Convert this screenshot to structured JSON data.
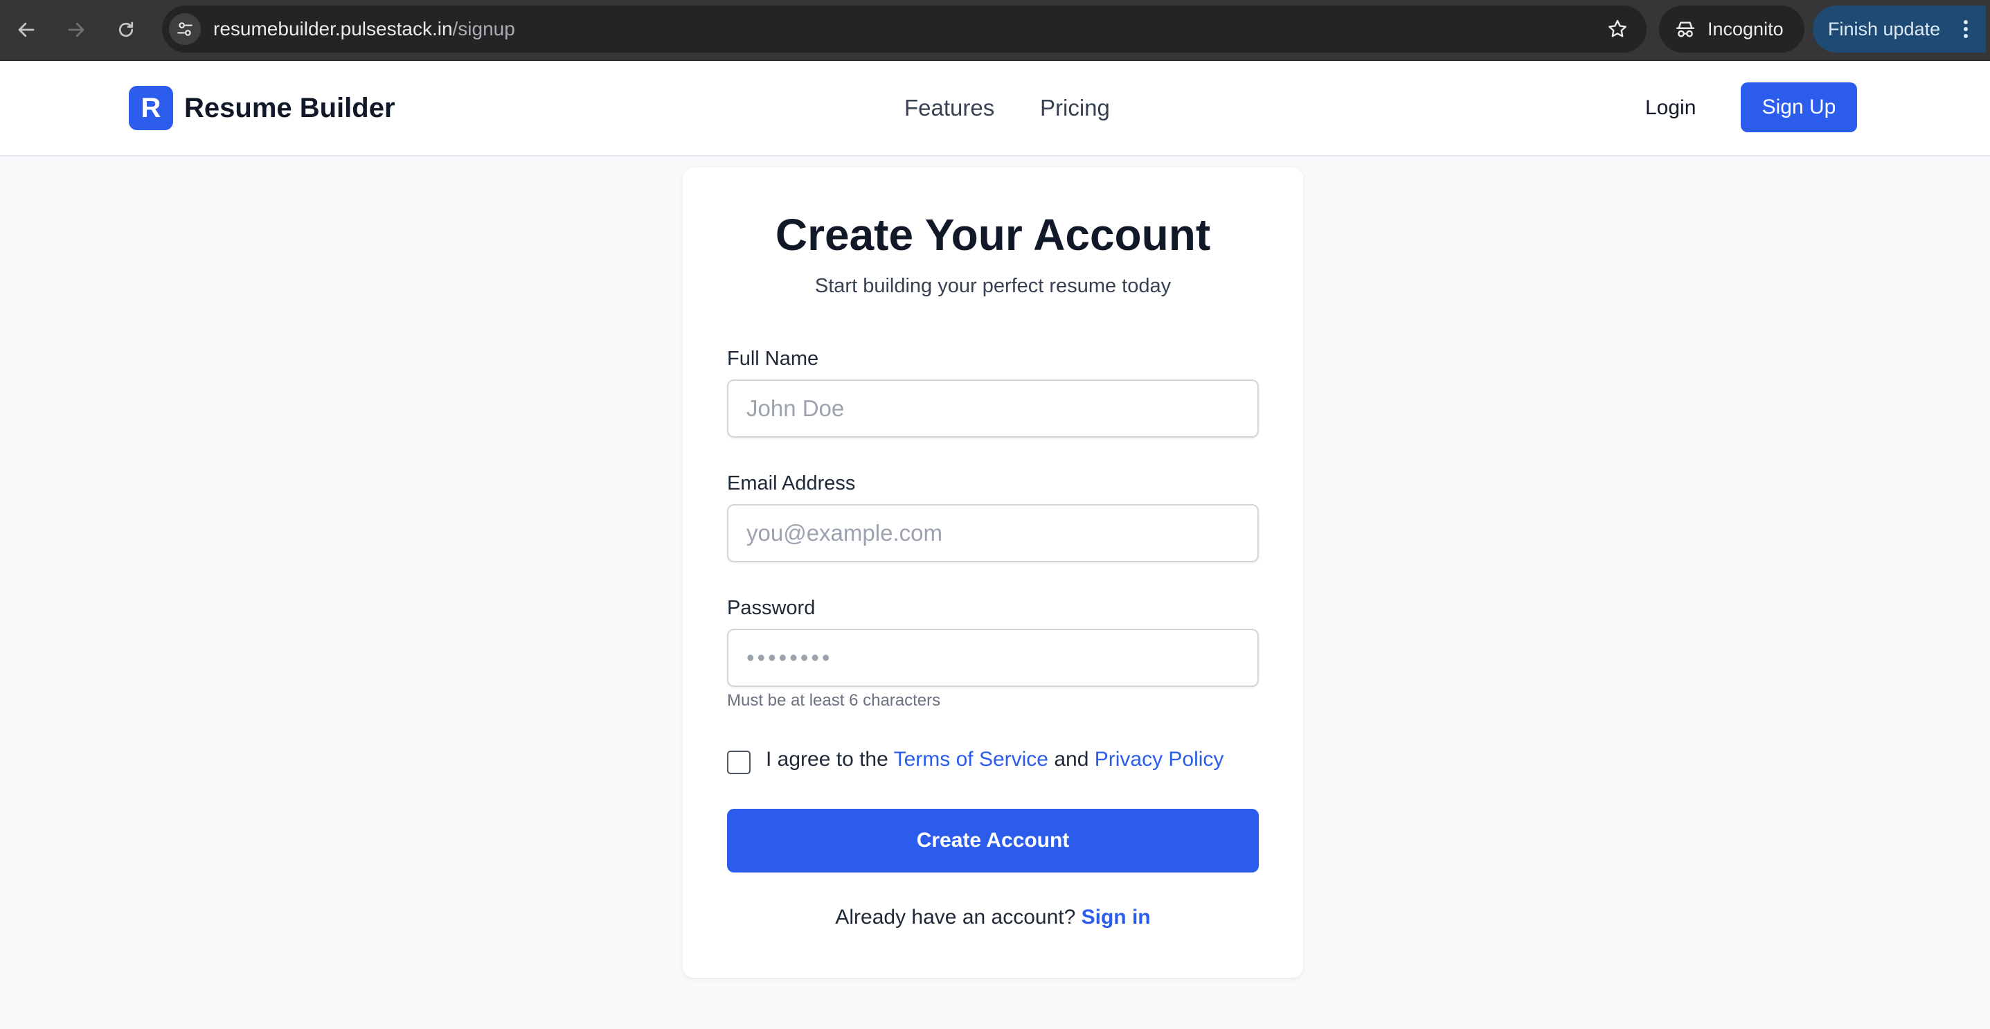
{
  "browser": {
    "url_host": "resumebuilder.pulsestack.in",
    "url_path": "/signup",
    "incognito_label": "Incognito",
    "update_label": "Finish update",
    "icons": [
      "back-arrow-icon",
      "forward-arrow-icon",
      "reload-icon",
      "tune-icon",
      "star-icon",
      "incognito-icon",
      "more-vert-icon"
    ]
  },
  "header": {
    "logo_letter": "R",
    "brand": "Resume Builder",
    "nav": [
      "Features",
      "Pricing"
    ],
    "login": "Login",
    "signup": "Sign Up"
  },
  "form": {
    "title": "Create Your Account",
    "subtitle": "Start building your perfect resume today",
    "full_name": {
      "label": "Full Name",
      "placeholder": "John Doe",
      "value": ""
    },
    "email": {
      "label": "Email Address",
      "placeholder": "you@example.com",
      "value": ""
    },
    "password": {
      "label": "Password",
      "placeholder": "••••••••",
      "value": "",
      "hint": "Must be at least 6 characters"
    },
    "agree": {
      "checked": false,
      "prefix": "I agree to the ",
      "terms": "Terms of Service",
      "middle": " and ",
      "privacy": "Privacy Policy"
    },
    "submit": "Create Account",
    "footer_text": "Already have an account? ",
    "footer_link": "Sign in"
  },
  "colors": {
    "primary": "#2b5ceb",
    "page_bg": "#f8fafc",
    "chrome_bg": "#363636",
    "update_pill": "#1e4a73"
  }
}
